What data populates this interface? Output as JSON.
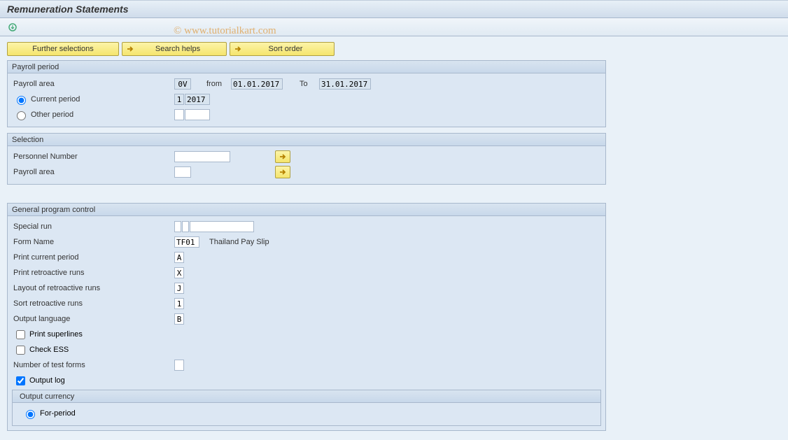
{
  "title": "Remuneration Statements",
  "watermark": "© www.tutorialkart.com",
  "buttons": {
    "further_selections": "Further selections",
    "search_helps": "Search helps",
    "sort_order": "Sort order"
  },
  "payroll_period": {
    "header": "Payroll period",
    "payroll_area_label": "Payroll area",
    "payroll_area_value": "0V",
    "from_label": "from",
    "from_value": "01.01.2017",
    "to_label": "To",
    "to_value": "31.01.2017",
    "current_period_label": "Current period",
    "current_period_num": "1",
    "current_period_year": "2017",
    "other_period_label": "Other period"
  },
  "selection": {
    "header": "Selection",
    "personnel_number_label": "Personnel Number",
    "payroll_area_label": "Payroll area"
  },
  "general": {
    "header": "General program control",
    "special_run_label": "Special run",
    "form_name_label": "Form Name",
    "form_name_value": "TF01",
    "form_name_desc": "Thailand Pay Slip",
    "print_current_label": "Print current period",
    "print_current_value": "A",
    "print_retro_label": "Print retroactive runs",
    "print_retro_value": "X",
    "layout_retro_label": "Layout of retroactive runs",
    "layout_retro_value": "J",
    "sort_retro_label": "Sort retroactive runs",
    "sort_retro_value": "1",
    "output_lang_label": "Output language",
    "output_lang_value": "B",
    "print_superlines_label": "Print superlines",
    "check_ess_label": "Check ESS",
    "num_test_forms_label": "Number of test forms",
    "output_log_label": "Output log",
    "output_currency_header": "Output currency",
    "for_period_label": "For-period"
  }
}
